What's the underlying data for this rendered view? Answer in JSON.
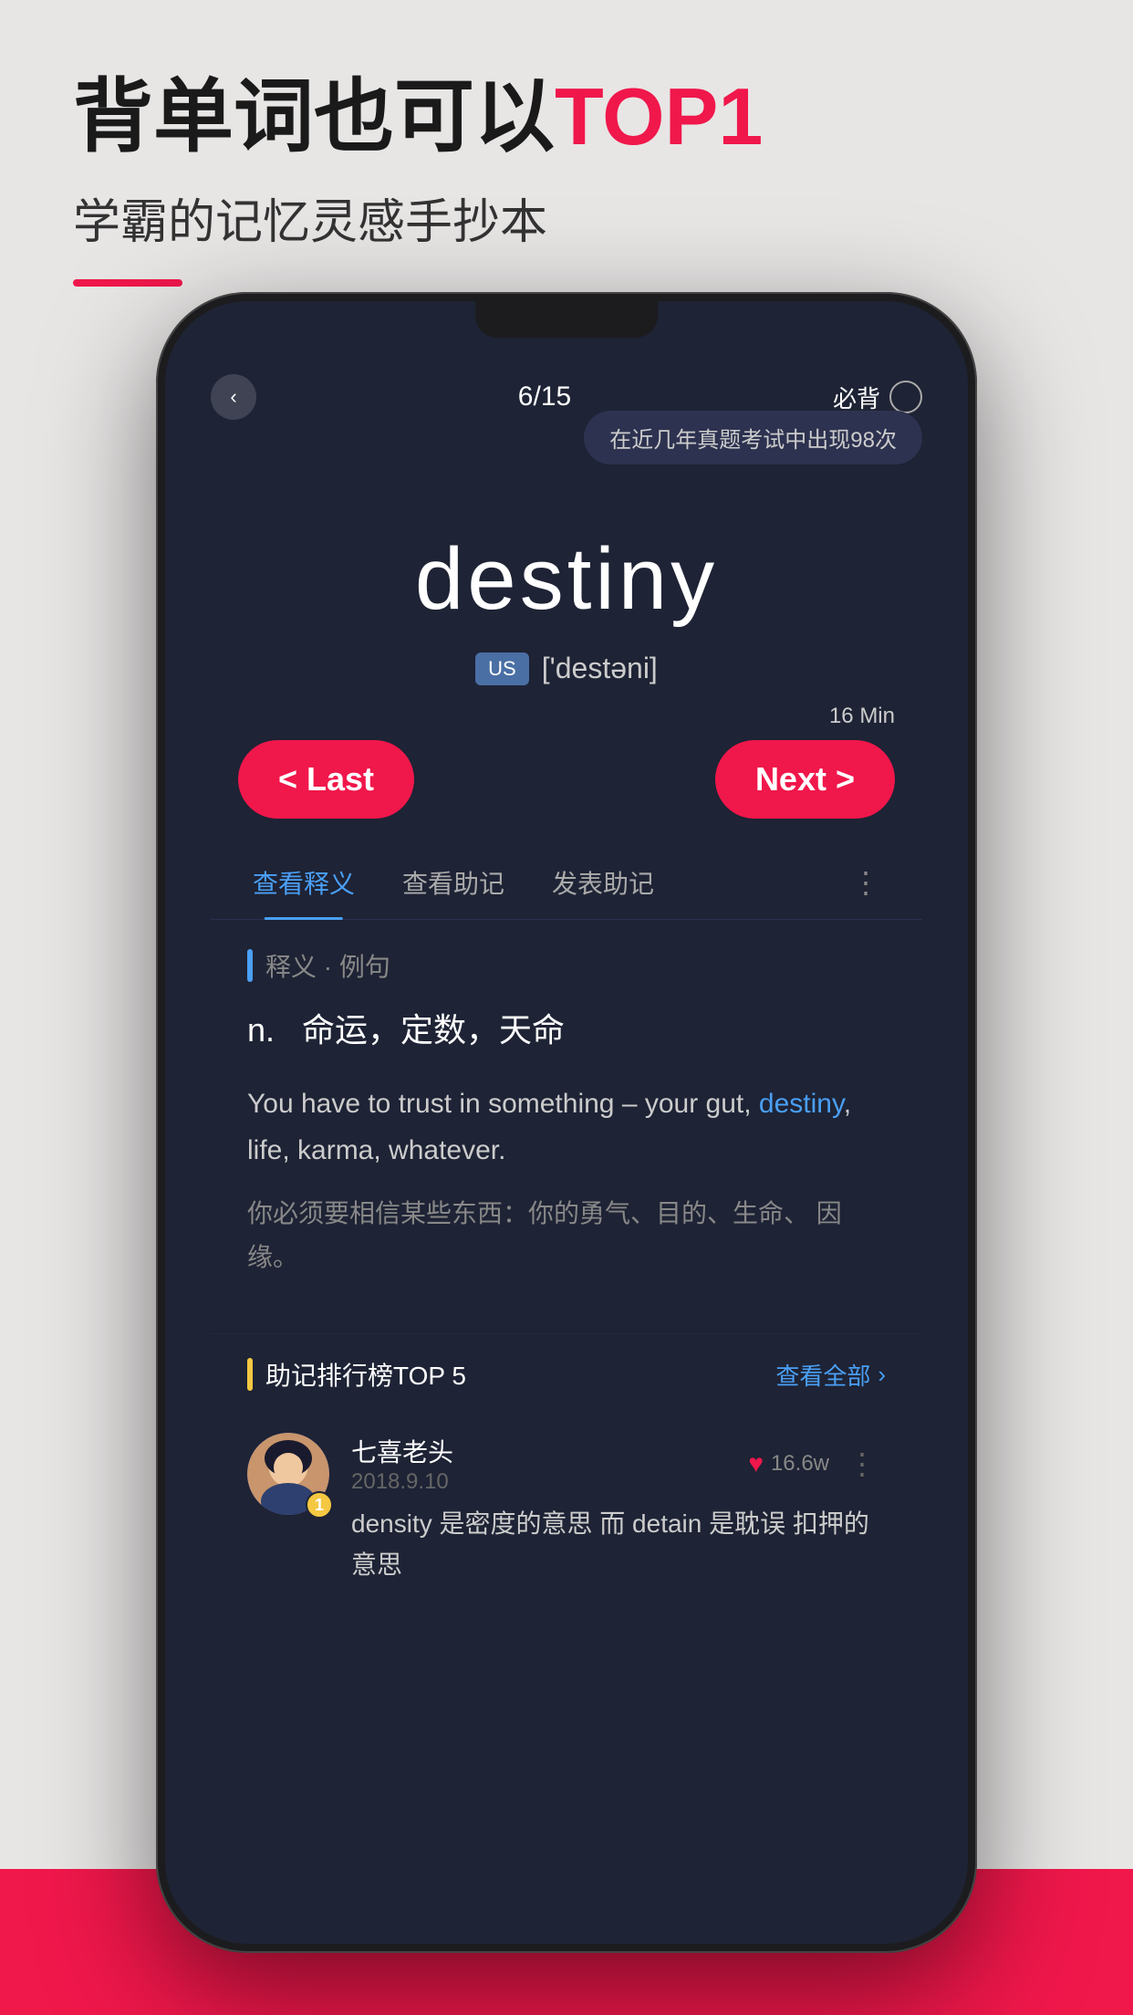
{
  "page": {
    "background_color": "#e8e5e5",
    "title_part1": "背单词也可以",
    "title_highlight": "TOP1",
    "subtitle": "学霸的记忆灵感手抄本",
    "title_underline_color": "#f0174b"
  },
  "phone": {
    "screen_bg": "#1e2335",
    "status": {
      "progress": "6/15",
      "must_memorize_label": "必背",
      "tooltip": "在近几年真题考试中出现98次"
    },
    "word": {
      "english": "destiny",
      "us_label": "US",
      "phonetic": "['destəni]",
      "timer": "16 Min"
    },
    "buttons": {
      "last_label": "< Last",
      "next_label": "Next >"
    },
    "tabs": [
      {
        "label": "查看释义",
        "active": true
      },
      {
        "label": "查看助记",
        "active": false
      },
      {
        "label": "发表助记",
        "active": false
      }
    ],
    "definition": {
      "section_label": "释义 · 例句",
      "pos": "n.",
      "meaning": "命运，定数，天命",
      "example_en_before": "You have to trust in something –\nyour gut, ",
      "example_en_highlight": "destiny",
      "example_en_after": ", life, karma, whatever.",
      "example_zh": "你必须要相信某些东西：你的勇气、目的、生命、\n因缘。"
    },
    "memory_ranking": {
      "section_label": "助记排行榜TOP 5",
      "view_all": "查看全部",
      "items": [
        {
          "rank": "1",
          "avatar_type": "photo",
          "username": "七喜老头",
          "date": "2018.9.10",
          "likes": "16.6w",
          "content": "density 是密度的意思  而 detain 是耽误\n扣押的意思"
        }
      ]
    }
  }
}
